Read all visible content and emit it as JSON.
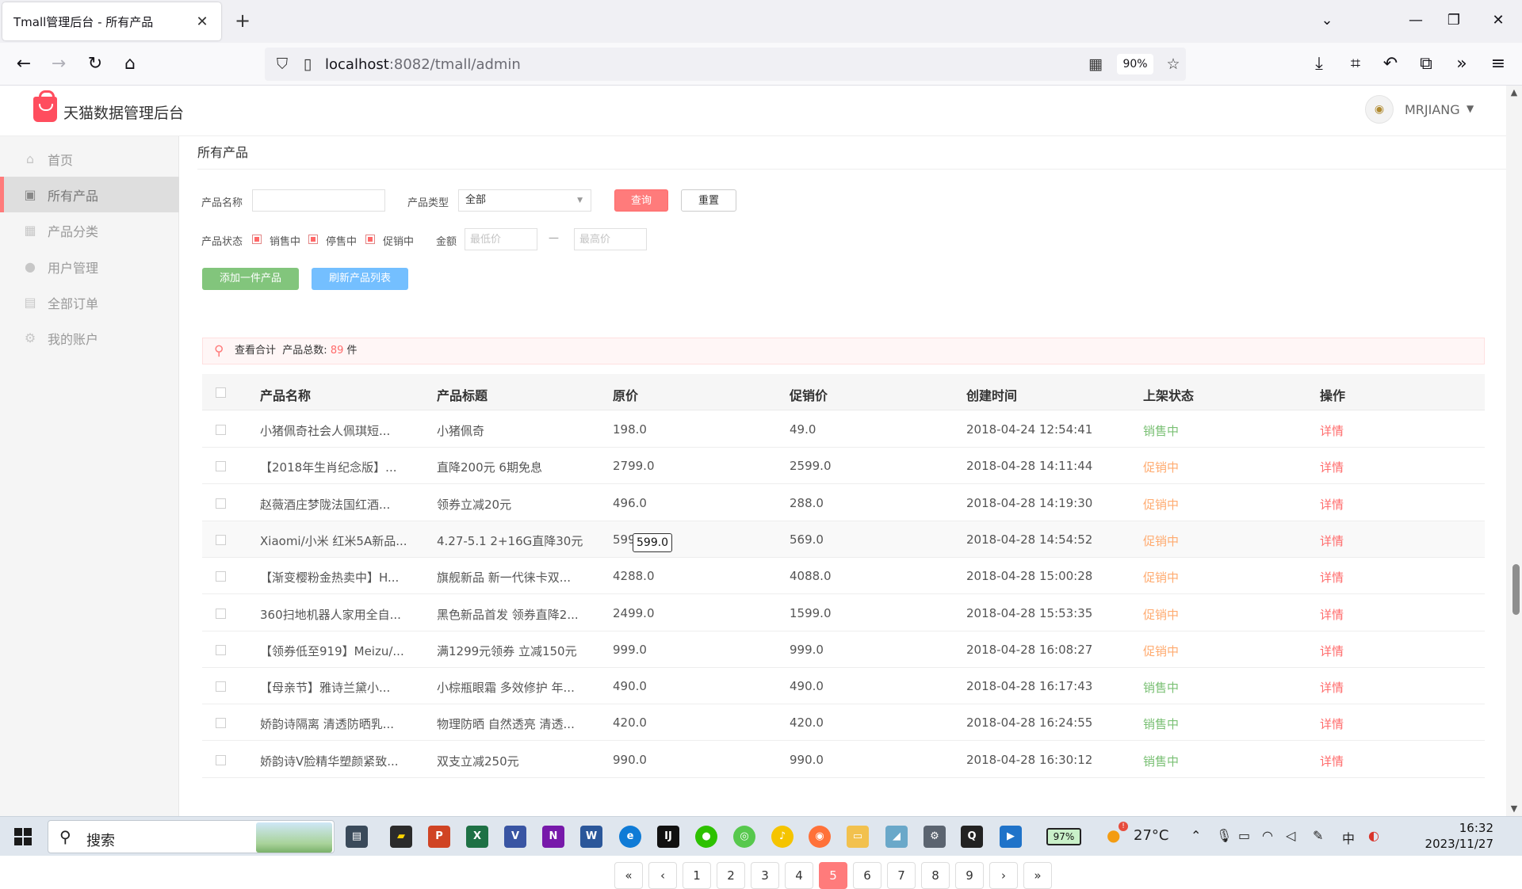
{
  "browser": {
    "tab_title": "Tmall管理后台 - 所有产品",
    "tab_close": "✕",
    "new_tab": "+",
    "url_host": "localhost",
    "url_path": ":8082/tmall/admin",
    "zoom": "90%"
  },
  "app": {
    "title": "天猫数据管理后台",
    "user_name": "MRJIANG"
  },
  "sidebar": {
    "items": [
      {
        "label": "首页",
        "icon": "home-icon"
      },
      {
        "label": "所有产品",
        "icon": "products-icon"
      },
      {
        "label": "产品分类",
        "icon": "category-icon"
      },
      {
        "label": "用户管理",
        "icon": "user-icon"
      },
      {
        "label": "全部订单",
        "icon": "orders-icon"
      },
      {
        "label": "我的账户",
        "icon": "gear-icon"
      }
    ]
  },
  "breadcrumb": "所有产品",
  "filters": {
    "name_label": "产品名称",
    "name_value": "",
    "type_label": "产品类型",
    "type_value": "全部",
    "query_button": "查询",
    "reset_button": "重置",
    "status_label": "产品状态",
    "status_options": [
      "销售中",
      "停售中",
      "促销中"
    ],
    "amount_label": "金额",
    "min_placeholder": "最低价",
    "max_placeholder": "最高价",
    "range_sep": "—"
  },
  "actions": {
    "add_button": "添加一件产品",
    "refresh_button": "刷新产品列表"
  },
  "summary": {
    "label": "查看合计",
    "count_label": "产品总数:",
    "count": "89",
    "unit": "件"
  },
  "table": {
    "columns": [
      "产品名称",
      "产品标题",
      "原价",
      "促销价",
      "创建时间",
      "上架状态",
      "操作"
    ],
    "rows": [
      {
        "name": "小猪佩奇社会人佩琪短...",
        "title": "小猪佩奇",
        "price": "198.0",
        "promo": "49.0",
        "created": "2018-04-24 12:54:41",
        "status": "销售中",
        "status_type": "on",
        "action": "详情"
      },
      {
        "name": "【2018年生肖纪念版】...",
        "title": "直降200元 6期免息",
        "price": "2799.0",
        "promo": "2599.0",
        "created": "2018-04-28 14:11:44",
        "status": "促销中",
        "status_type": "promo",
        "action": "详情"
      },
      {
        "name": "赵薇酒庄梦陇法国红酒...",
        "title": "领券立减20元",
        "price": "496.0",
        "promo": "288.0",
        "created": "2018-04-28 14:19:30",
        "status": "促销中",
        "status_type": "promo",
        "action": "详情"
      },
      {
        "name": "Xiaomi/小米 红米5A新品...",
        "title": "4.27-5.1 2+16G直降30元",
        "price": "599.0",
        "promo": "569.0",
        "created": "2018-04-28 14:54:52",
        "status": "促销中",
        "status_type": "promo",
        "action": "详情"
      },
      {
        "name": "【渐变樱粉金热卖中】H...",
        "title": "旗舰新品 新一代徕卡双...",
        "price": "4288.0",
        "promo": "4088.0",
        "created": "2018-04-28 15:00:28",
        "status": "促销中",
        "status_type": "promo",
        "action": "详情"
      },
      {
        "name": "360扫地机器人家用全自...",
        "title": "黑色新品首发 领券直降2...",
        "price": "2499.0",
        "promo": "1599.0",
        "created": "2018-04-28 15:53:35",
        "status": "促销中",
        "status_type": "promo",
        "action": "详情"
      },
      {
        "name": "【领券低至919】Meizu/...",
        "title": "满1299元领券 立减150元",
        "price": "999.0",
        "promo": "999.0",
        "created": "2018-04-28 16:08:27",
        "status": "促销中",
        "status_type": "promo",
        "action": "详情"
      },
      {
        "name": "【母亲节】雅诗兰黛小...",
        "title": "小棕瓶眼霜 多效修护 年...",
        "price": "490.0",
        "promo": "490.0",
        "created": "2018-04-28 16:17:43",
        "status": "销售中",
        "status_type": "on",
        "action": "详情"
      },
      {
        "name": "娇韵诗隔离 清透防晒乳...",
        "title": "物理防晒 自然透亮 清透...",
        "price": "420.0",
        "promo": "420.0",
        "created": "2018-04-28 16:24:55",
        "status": "销售中",
        "status_type": "on",
        "action": "详情"
      },
      {
        "name": "娇韵诗V脸精华塑颜紧致...",
        "title": "双支立减250元",
        "price": "990.0",
        "promo": "990.0",
        "created": "2018-04-28 16:30:12",
        "status": "销售中",
        "status_type": "on",
        "action": "详情"
      }
    ]
  },
  "tooltip": "599.0",
  "pagination": {
    "first": "«",
    "prev": "‹",
    "pages": [
      "1",
      "2",
      "3",
      "4",
      "5",
      "6",
      "7",
      "8",
      "9"
    ],
    "current": "5",
    "next": "›",
    "last": "»"
  },
  "taskbar": {
    "search_label": "搜索",
    "battery": "97%",
    "weather": "27°C",
    "weather_badge": "!",
    "time": "16:32",
    "date": "2023/11/27",
    "ime": "中"
  },
  "colors": {
    "accent": "#ff7b7b",
    "status_on": "#7ac074",
    "status_promo": "#ffab70",
    "add_button": "#82c57c",
    "refresh_button": "#74bfff"
  }
}
